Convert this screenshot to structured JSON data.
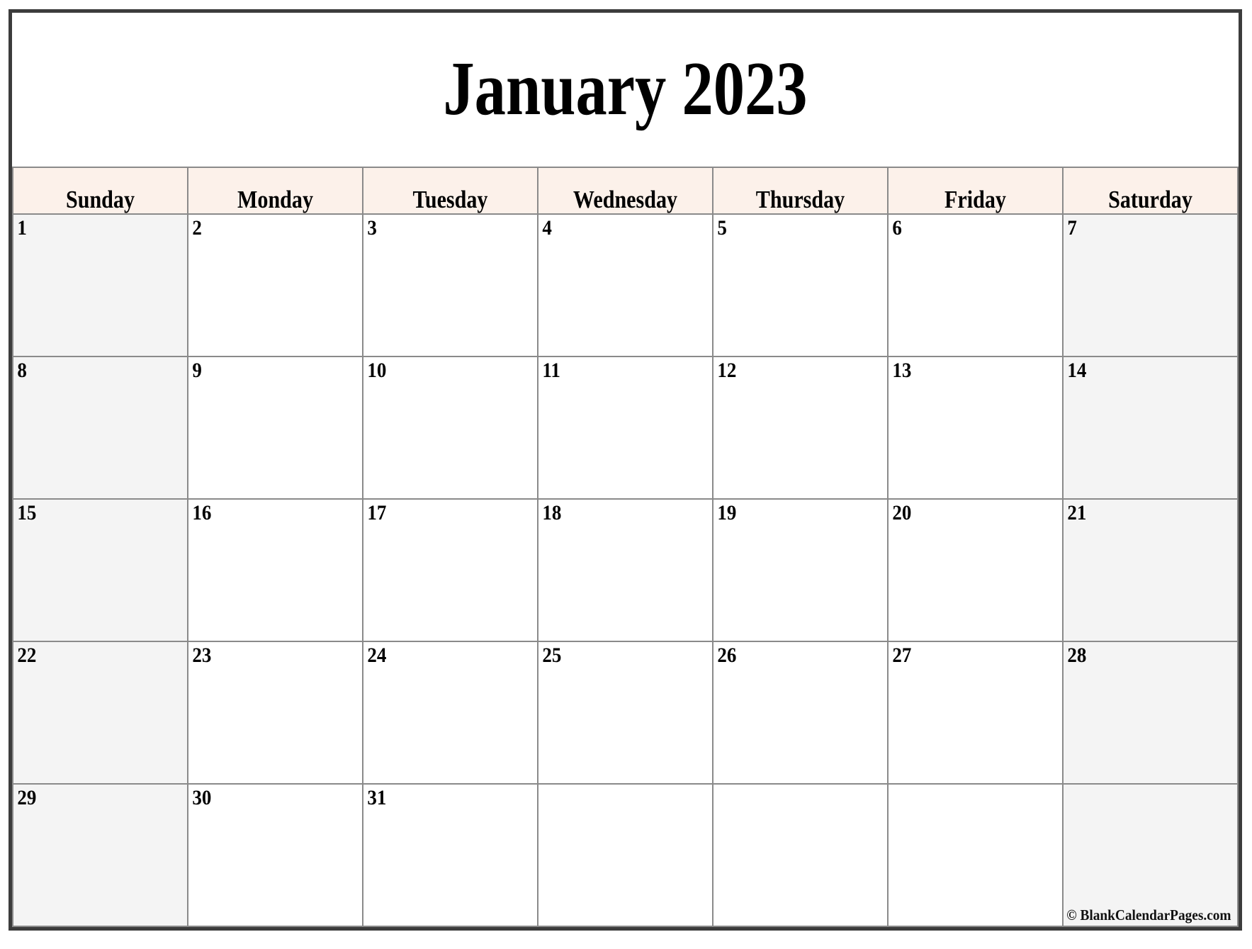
{
  "calendar": {
    "title": "January 2023",
    "month": "January",
    "year": "2023",
    "weekday_headers": [
      "Sunday",
      "Monday",
      "Tuesday",
      "Wednesday",
      "Thursday",
      "Friday",
      "Saturday"
    ],
    "weeks": [
      [
        "1",
        "2",
        "3",
        "4",
        "5",
        "6",
        "7"
      ],
      [
        "8",
        "9",
        "10",
        "11",
        "12",
        "13",
        "14"
      ],
      [
        "15",
        "16",
        "17",
        "18",
        "19",
        "20",
        "21"
      ],
      [
        "22",
        "23",
        "24",
        "25",
        "26",
        "27",
        "28"
      ],
      [
        "29",
        "30",
        "31",
        "",
        "",
        "",
        ""
      ]
    ],
    "credit": "© BlankCalendarPages.com",
    "colors": {
      "header_background": "#fcf1ea",
      "weekend_background": "#f4f4f4",
      "weekday_background": "#ffffff",
      "grid_line": "#8a8a8a",
      "outer_frame": "#3c3c3c",
      "text": "#000000"
    }
  }
}
